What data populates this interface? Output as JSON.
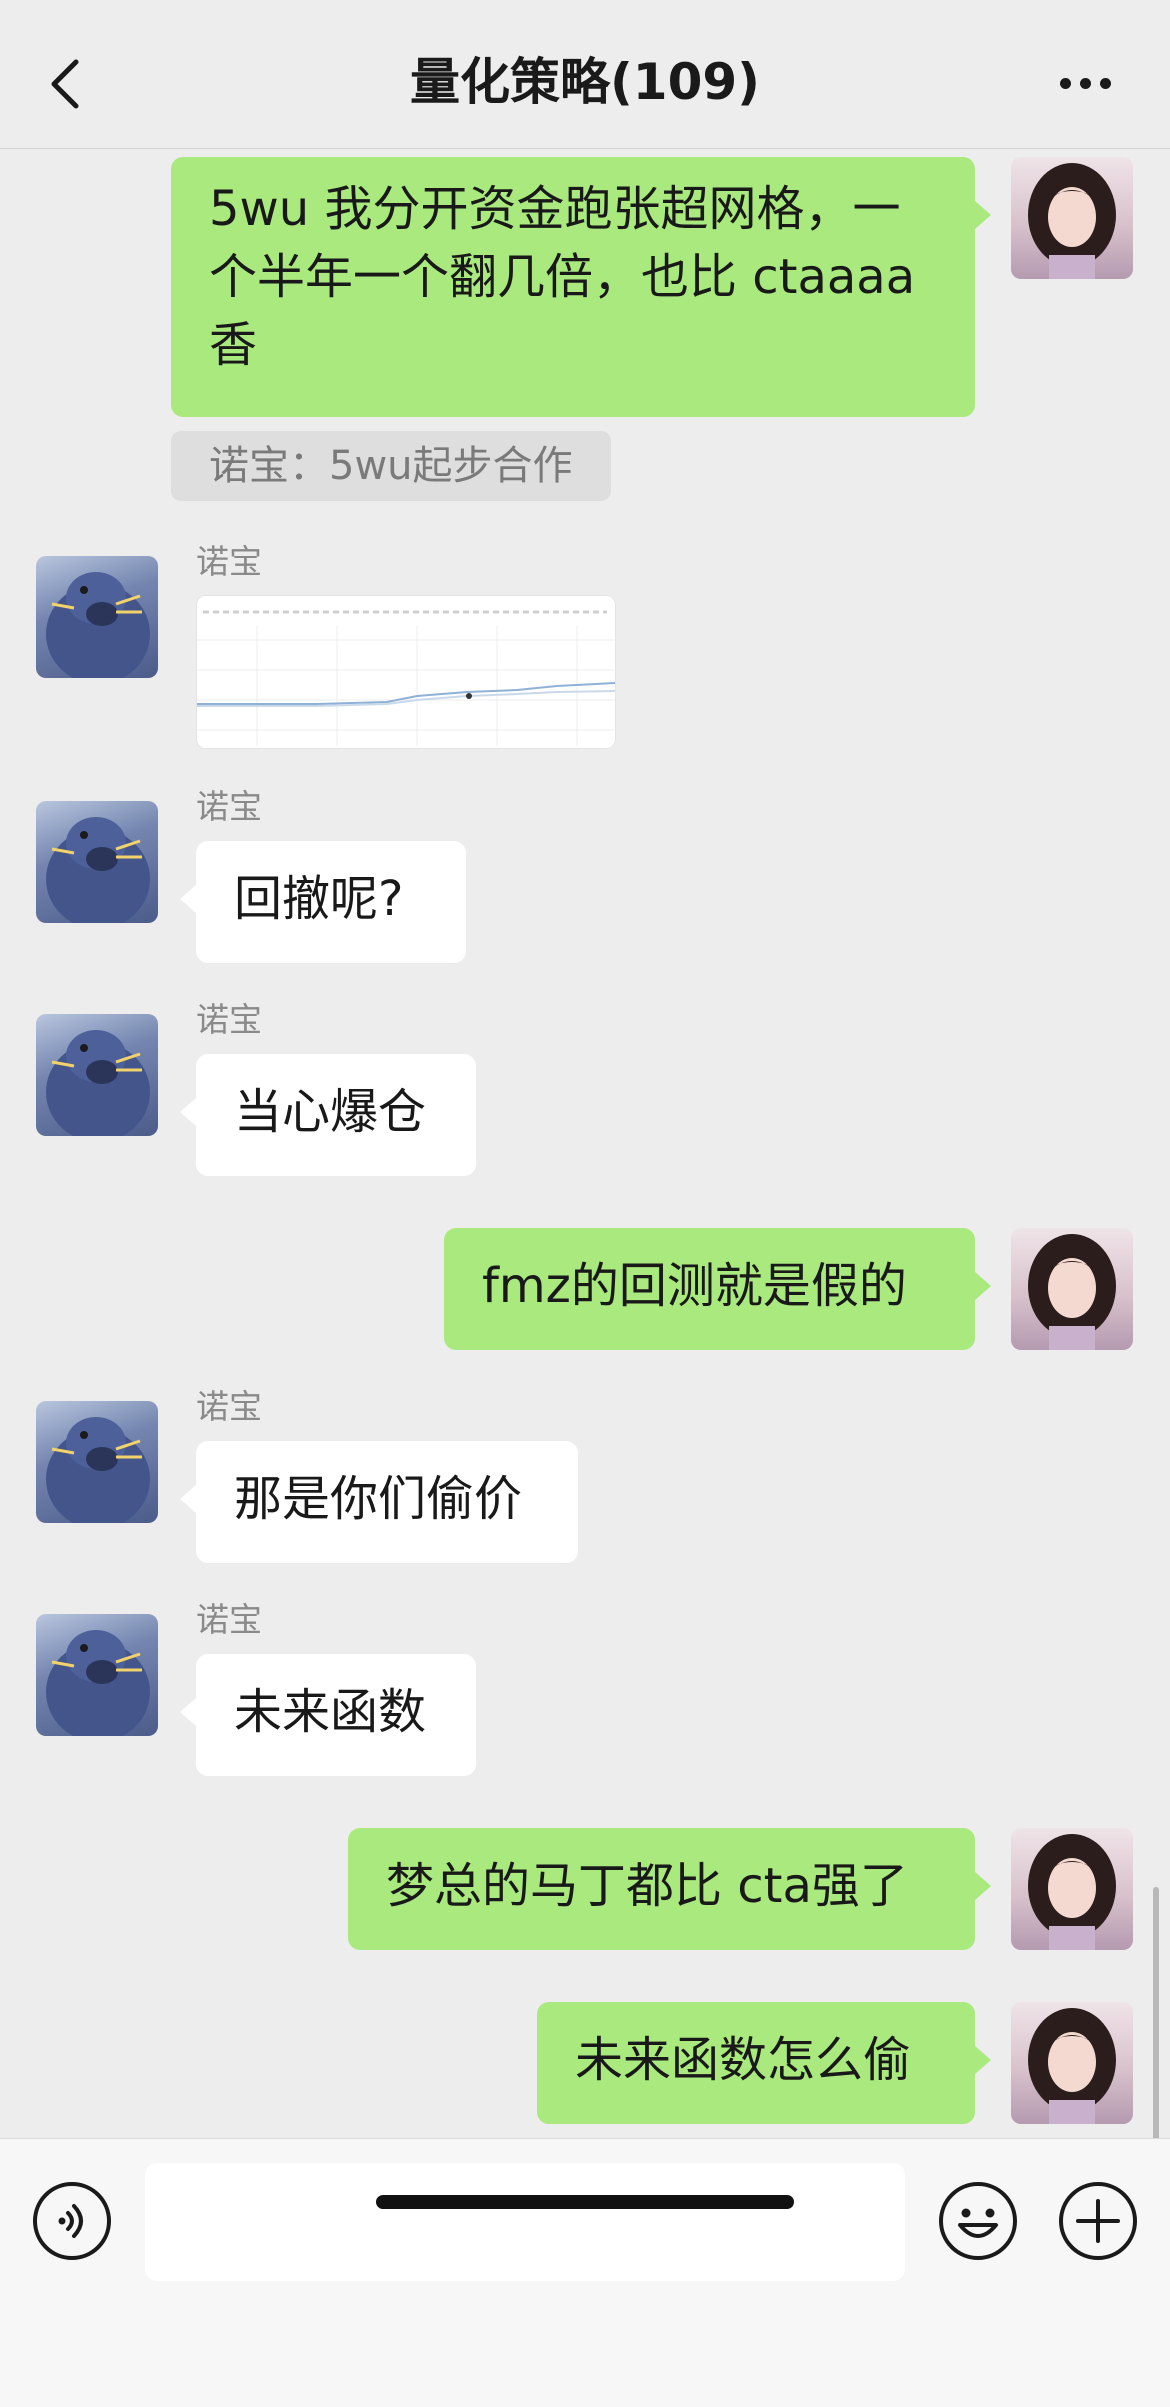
{
  "header": {
    "title": "量化策略(109)",
    "back_icon": "chevron-left-icon",
    "more_icon": "more-dots-icon"
  },
  "messages": [
    {
      "side": "out",
      "text": "5wu 我分开资金跑张超网格，一个半年一个翻几倍，也比 ctaaaa 香"
    },
    {
      "type": "quote",
      "text": "诺宝：5wu起步合作"
    },
    {
      "side": "in",
      "sender": "诺宝",
      "type": "image"
    },
    {
      "side": "in",
      "sender": "诺宝",
      "text": "回撤呢?"
    },
    {
      "side": "in",
      "sender": "诺宝",
      "text": "当心爆仓"
    },
    {
      "side": "out",
      "text": "fmz的回测就是假的"
    },
    {
      "side": "in",
      "sender": "诺宝",
      "text": "那是你们偷价"
    },
    {
      "side": "in",
      "sender": "诺宝",
      "text": "未来函数"
    },
    {
      "side": "out",
      "text": "梦总的马丁都比 cta强了"
    },
    {
      "side": "out",
      "text": "未来函数怎么偷"
    }
  ],
  "colors": {
    "background": "#ededed",
    "outgoing_bubble": "#a9e97e",
    "incoming_bubble": "#ffffff"
  },
  "input_bar": {
    "voice_icon": "voice-icon",
    "emoji_icon": "emoji-icon",
    "plus_icon": "plus-icon",
    "text_value": ""
  }
}
